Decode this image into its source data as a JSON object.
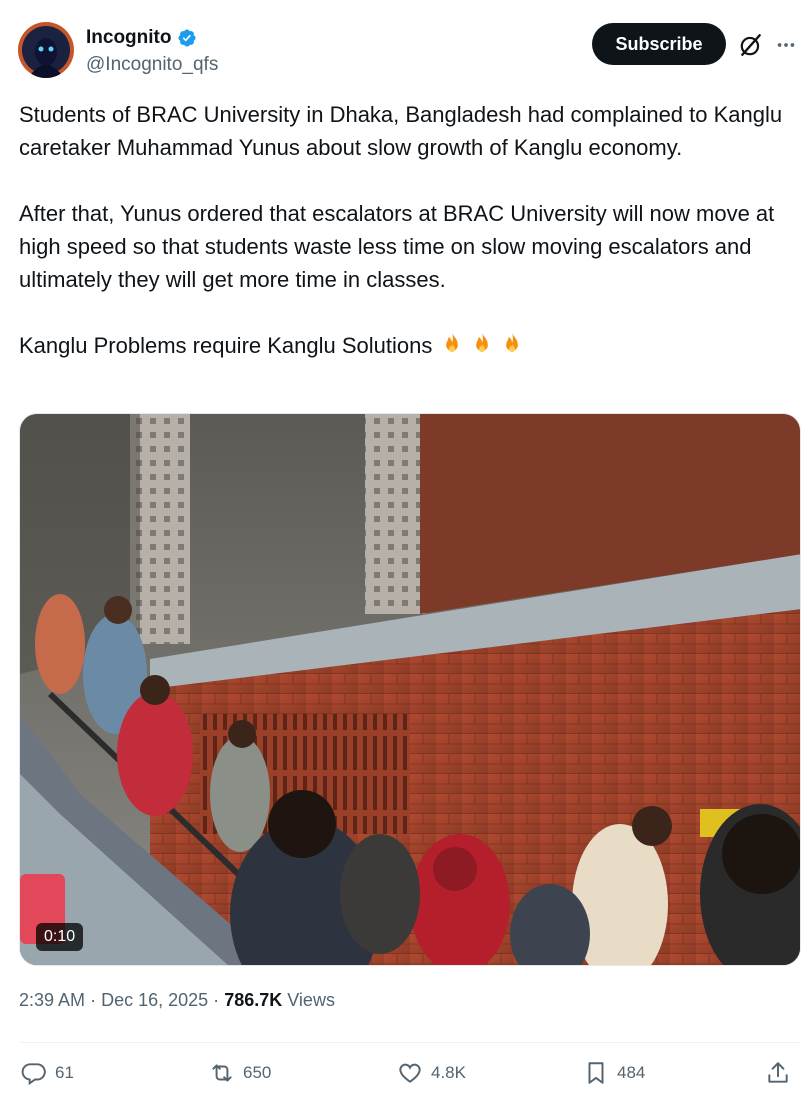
{
  "author": {
    "name": "Incognito",
    "handle": "@Incognito_qfs",
    "verified_color": "#1d9bf0",
    "avatar_icon": "blue-eyed-hooded-figure-avatar"
  },
  "header": {
    "subscribe_label": "Subscribe",
    "grok_icon": "grok-icon",
    "more_icon": "more-horizontal-icon"
  },
  "post": {
    "paragraphs": [
      "Students of BRAC University in Dhaka, Bangladesh had complained to Kanglu caretaker Muhammad Yunus about slow growth of Kanglu economy.",
      "After that, Yunus ordered that escalators at BRAC University will now move at high speed so that students waste less time on slow moving escalators and ultimately they will get more time in classes.",
      "Kanglu Problems require Kanglu Solutions"
    ],
    "emoji": "fire-emoji x3"
  },
  "video": {
    "duration": "0:10"
  },
  "meta": {
    "time": "2:39 AM",
    "separator": "·",
    "date": "Dec 16, 2025",
    "views_count": "786.7K",
    "views_label": "Views"
  },
  "actions": {
    "replies": "61",
    "reposts": "650",
    "likes": "4.8K",
    "bookmarks": "484"
  },
  "colors": {
    "text": "#0f1419",
    "secondary": "#536471",
    "accent": "#1d9bf0"
  }
}
